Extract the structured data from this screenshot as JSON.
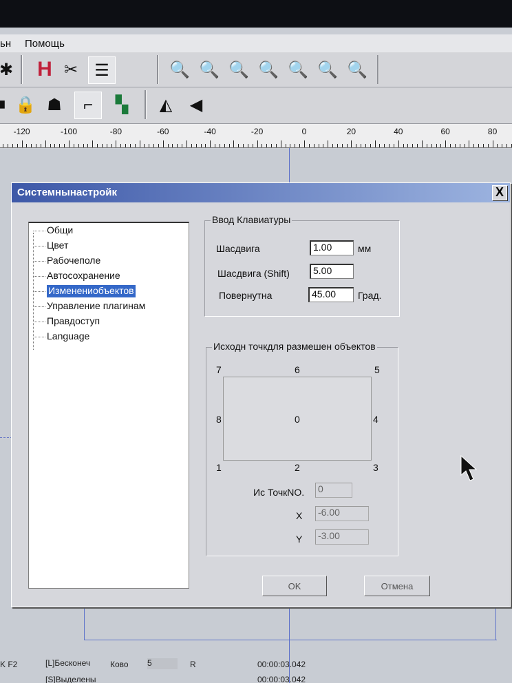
{
  "menu": {
    "items": [
      "ьн",
      "Помощь"
    ]
  },
  "ruler": {
    "labels": [
      "-120",
      "-100",
      "-80",
      "-60",
      "-40",
      "-20",
      "0",
      "20",
      "40",
      "60",
      "80"
    ]
  },
  "dialog": {
    "title": "Системнынастройк",
    "close_label": "X",
    "tree": [
      "Общи",
      "Цвет",
      "Рабочеполе",
      "Автосохранение",
      "Изменениобъектов",
      "Управление плагинам",
      "Правдоступ",
      "Language"
    ],
    "selected_index": 4,
    "keyboard_group": {
      "title": "Ввод Клавиатуры",
      "rows": [
        {
          "label": "Шасдвига",
          "value": "1.00",
          "unit": "мм"
        },
        {
          "label": "Шасдвига (Shift)",
          "value": "5.00",
          "unit": ""
        },
        {
          "label": "Повернутна",
          "value": "45.00",
          "unit": "Град."
        }
      ]
    },
    "origin_group": {
      "title": "Исходн точкдля размешен объектов",
      "points": [
        "7",
        "6",
        "5",
        "8",
        "0",
        "4",
        "1",
        "2",
        "3"
      ],
      "start_label": "Ис ТочкNO.",
      "start_value": "0",
      "x_label": "X",
      "x_value": "-6.00",
      "y_label": "Y",
      "y_value": "-3.00"
    },
    "ok_label": "OK",
    "cancel_label": "Отмена"
  },
  "status": {
    "left_key": "K F2",
    "infinite": "[L]Бесконеч",
    "kovo": "Ково",
    "count": "5",
    "unit": "R",
    "time1": "00:00:03.042",
    "selected": "[S]Выделены",
    "time2": "00:00:03.042"
  }
}
